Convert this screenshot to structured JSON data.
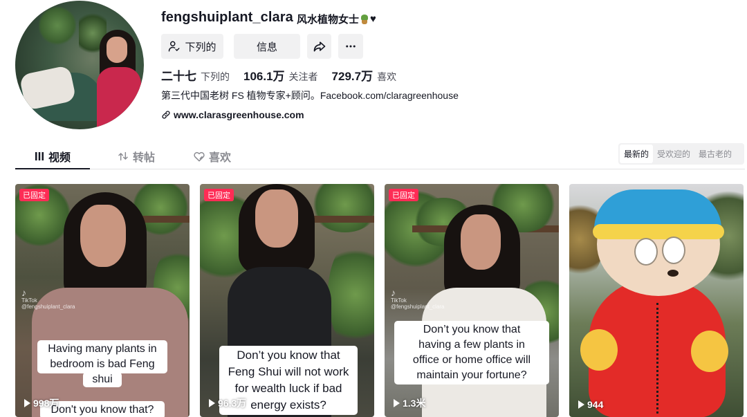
{
  "profile": {
    "username": "fengshuiplant_clara",
    "nickname": "风水植物女士",
    "nickname_suffix": "♥",
    "follow_button": "下列的",
    "message_button": "信息",
    "stats": [
      {
        "value": "二十七",
        "label": "下列的"
      },
      {
        "value": "106.1万",
        "label": "关注者"
      },
      {
        "value": "729.7万",
        "label": "喜欢"
      }
    ],
    "bio": "第三代中国老树 FS 植物专家+顾问。Facebook.com/claragreenhouse",
    "link": "www.clarasgreenhouse.com"
  },
  "tabs": [
    {
      "label": "视频",
      "active": true
    },
    {
      "label": "转帖",
      "active": false
    },
    {
      "label": "喜欢",
      "active": false
    }
  ],
  "sort": {
    "options": [
      "最新的",
      "受欢迎的",
      "最古老的"
    ],
    "selected": "最新的"
  },
  "videos": [
    {
      "pinned": "已固定",
      "caption_lines": [
        "Having many plants in",
        "bedroom is bad Feng",
        "shui"
      ],
      "caption_lower": "Don't you know that?",
      "views": "998万",
      "watermark": "TikTok",
      "watermark_user": "@fengshuiplant_clara"
    },
    {
      "pinned": "已固定",
      "caption_lines": [
        "Don’t you know that",
        "Feng Shui will not work",
        "for wealth luck if bad",
        "energy exists?"
      ],
      "views": "96.3万"
    },
    {
      "pinned": "已固定",
      "caption_lines": [
        "Don’t you know that",
        "having a few plants in",
        "office or home office will",
        "maintain your fortune?"
      ],
      "views": "1.3米",
      "watermark": "TikTok",
      "watermark_user": "@fengshuiplant_clara"
    },
    {
      "pinned": "",
      "caption_lines": [],
      "views": "944"
    }
  ],
  "colors": {
    "accent": "#fe2c55",
    "text_primary": "#161823",
    "button_bg": "#f1f1f2"
  },
  "icons": [
    "user-check-icon",
    "share-icon",
    "more-icon",
    "link-icon",
    "grid-icon",
    "repost-icon",
    "heart-slash-icon",
    "play-icon"
  ]
}
